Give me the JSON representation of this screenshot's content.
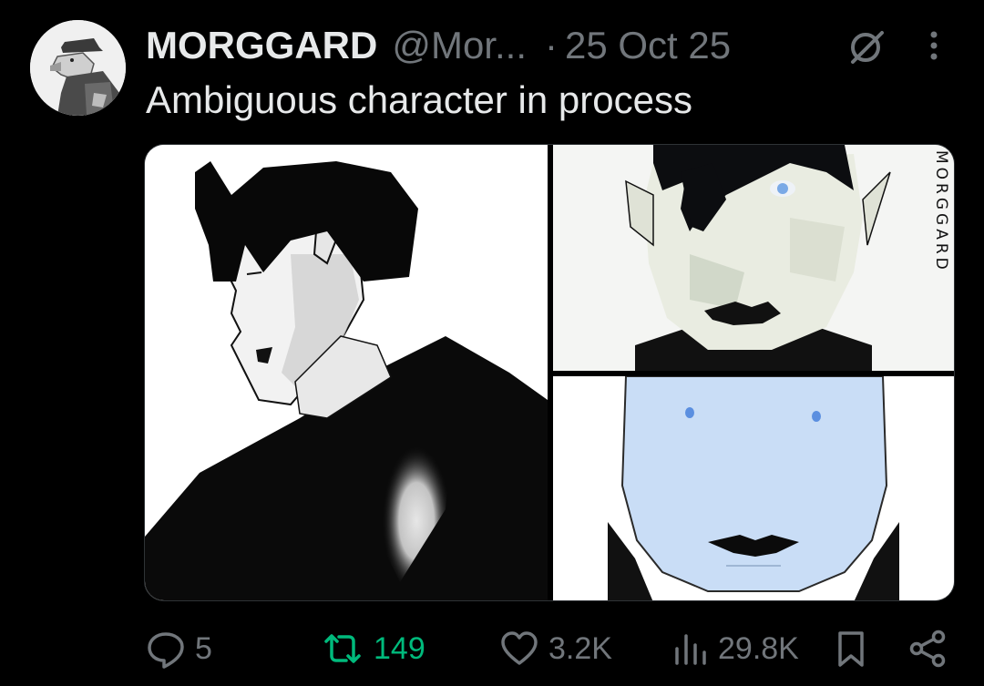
{
  "post": {
    "author_name": "MORGGARD",
    "author_handle": "@Mor...",
    "separator": "·",
    "date": "25 Oct 25",
    "text": "Ambiguous character in process"
  },
  "media": {
    "count": 3,
    "watermark": "MORGGARD"
  },
  "actions": {
    "replies": "5",
    "reposts": "149",
    "likes": "3.2K",
    "views": "29.8K"
  },
  "colors": {
    "background": "#000000",
    "primary_text": "#e7e9ea",
    "secondary_text": "#71767b",
    "repost_active": "#00ba7c"
  },
  "icons": {
    "header": [
      "grok-icon",
      "more-icon"
    ],
    "actions": [
      "reply-icon",
      "repost-icon",
      "like-icon",
      "views-icon",
      "bookmark-icon",
      "share-icon"
    ]
  }
}
